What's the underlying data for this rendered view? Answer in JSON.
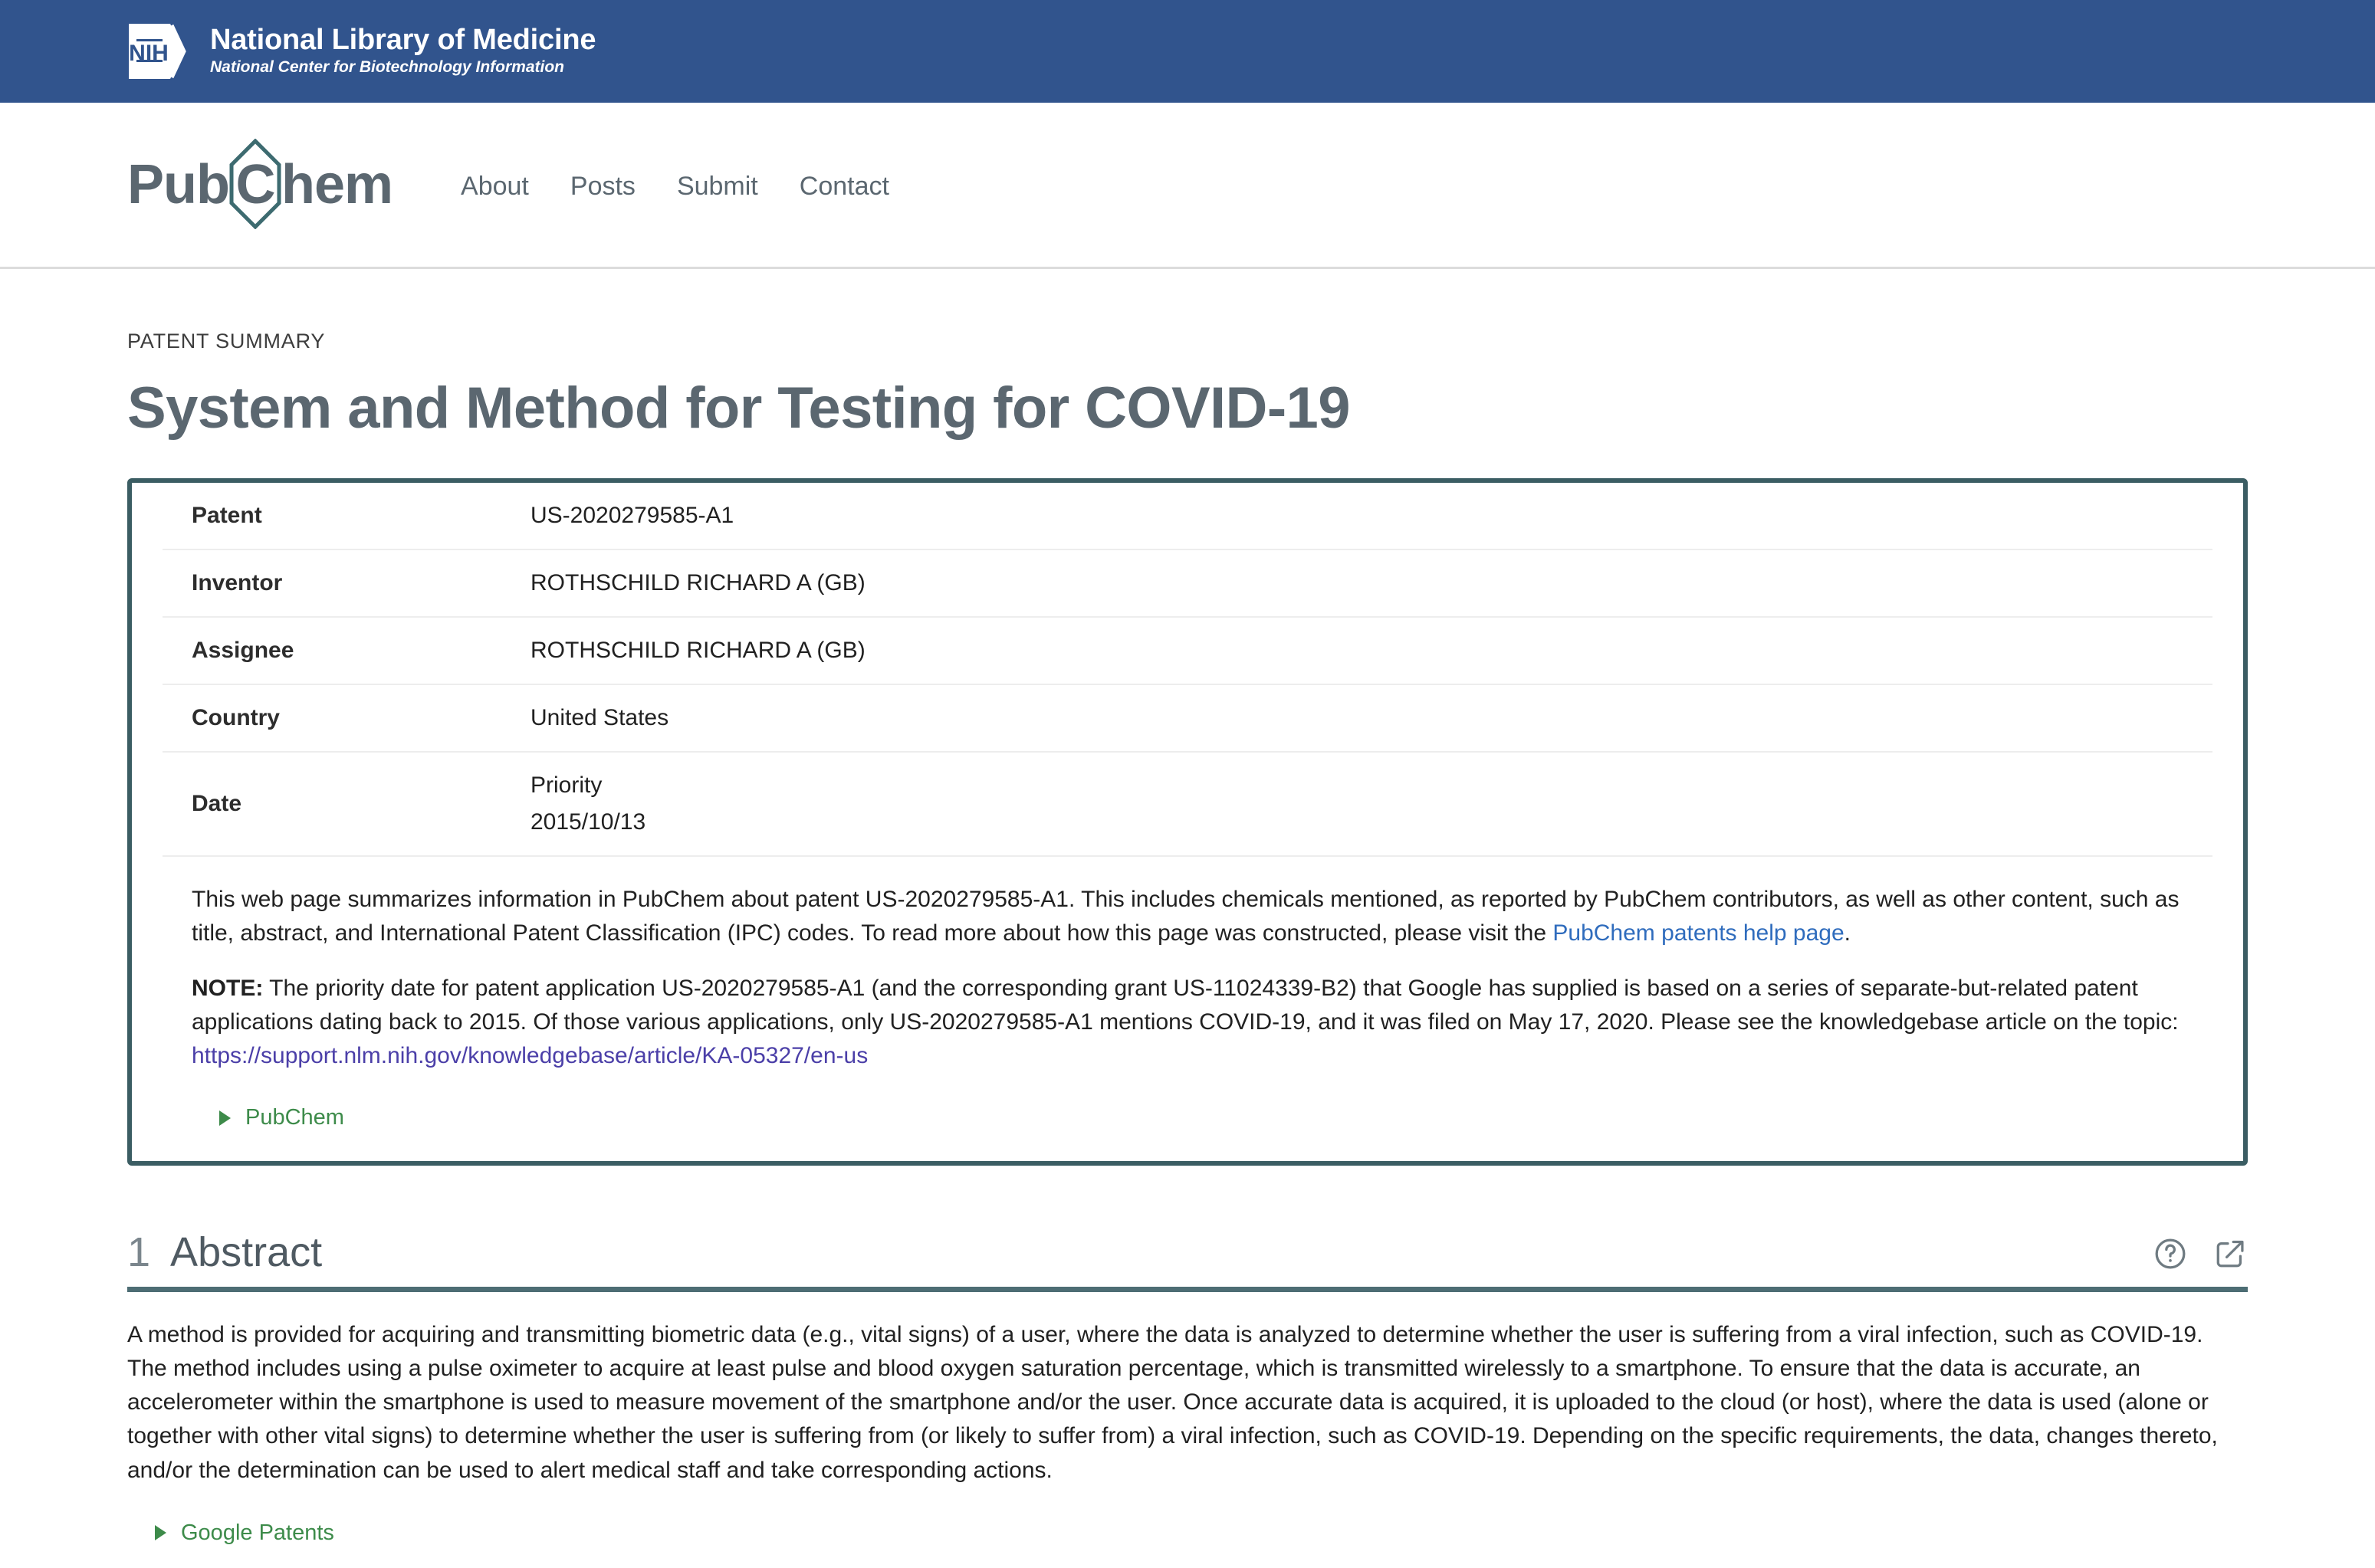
{
  "nih_header": {
    "logo_text": "NIH",
    "title": "National Library of Medicine",
    "subtitle": "National Center for Biotechnology Information",
    "background_color": "#31548d"
  },
  "nav": {
    "brand_part1": "Pub",
    "brand_hex": "C",
    "brand_part2": "hem",
    "links": [
      {
        "label": "About"
      },
      {
        "label": "Posts"
      },
      {
        "label": "Submit"
      },
      {
        "label": "Contact"
      }
    ]
  },
  "page": {
    "eyebrow": "PATENT SUMMARY",
    "title": "System and Method for Testing for COVID-19"
  },
  "summary_card": {
    "border_color": "#3b5d63",
    "rows": [
      {
        "label": "Patent",
        "value": "US-2020279585-A1"
      },
      {
        "label": "Inventor",
        "value": "ROTHSCHILD RICHARD A (GB)"
      },
      {
        "label": "Assignee",
        "value": "ROTHSCHILD RICHARD A (GB)"
      },
      {
        "label": "Country",
        "value": "United States"
      }
    ],
    "date_row": {
      "label": "Date",
      "value_line1": "Priority",
      "value_line2": "2015/10/13"
    },
    "description": {
      "part1": "This web page summarizes information in PubChem about patent US-2020279585-A1. This includes chemicals mentioned, as reported by PubChem contributors, as well as other content, such as title, abstract, and International Patent Classification (IPC) codes. To read more about how this page was constructed, please visit the ",
      "link_text": "PubChem patents help page",
      "part2": "."
    },
    "note": {
      "prefix": "NOTE:",
      "body": " The priority date for patent application US-2020279585-A1 (and the corresponding grant US-11024339-B2) that Google has supplied is based on a series of separate-but-related patent applications dating back to 2015. Of those various applications, only US-2020279585-A1 mentions COVID-19, and it was filed on May 17, 2020. Please see the knowledgebase article on the topic: ",
      "link_text": "https://support.nlm.nih.gov/knowledgebase/article/KA-05327/en-us"
    },
    "accordion_label": "PubChem"
  },
  "abstract_section": {
    "number": "1",
    "title": "Abstract",
    "help_icon": "help-circle-icon",
    "external_icon": "external-link-icon",
    "body": "A method is provided for acquiring and transmitting biometric data (e.g., vital signs) of a user, where the data is analyzed to determine whether the user is suffering from a viral infection, such as COVID-19. The method includes using a pulse oximeter to acquire at least pulse and blood oxygen saturation percentage, which is transmitted wirelessly to a smartphone. To ensure that the data is accurate, an accelerometer within the smartphone is used to measure movement of the smartphone and/or the user. Once accurate data is acquired, it is uploaded to the cloud (or host), where the data is used (alone or together with other vital signs) to determine whether the user is suffering from (or likely to suffer from) a viral infection, such as COVID-19. Depending on the specific requirements, the data, changes thereto, and/or the determination can be used to alert medical staff and take corresponding actions.",
    "accordion_label": "Google Patents"
  }
}
